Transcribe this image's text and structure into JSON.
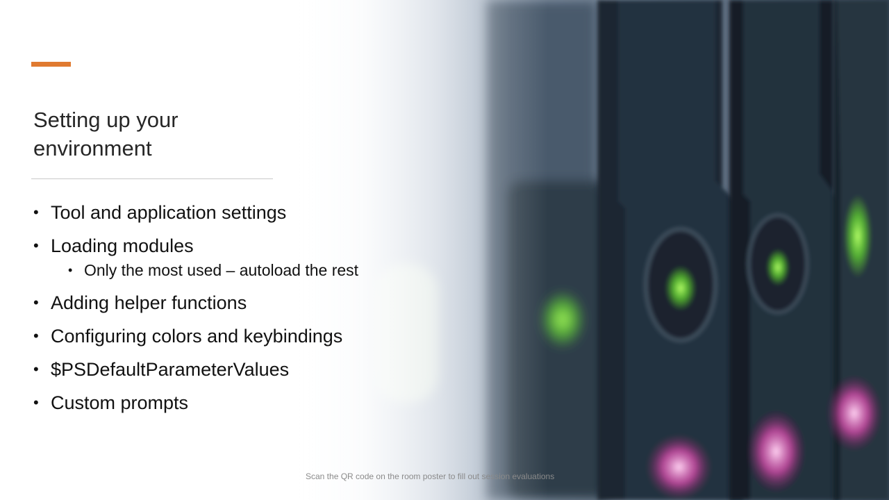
{
  "slide": {
    "title_lines": [
      "Setting up your",
      "environment"
    ],
    "bullets": [
      {
        "text": "Tool and application settings"
      },
      {
        "text": "Loading modules",
        "sub": "Only the most used – autoload the rest"
      },
      {
        "text": "Adding helper functions"
      },
      {
        "text": "Configuring colors and keybindings"
      },
      {
        "text": "$PSDefaultParameterValues"
      },
      {
        "text": "Custom prompts"
      }
    ],
    "bullet_glyph": "•",
    "footer": "Scan the QR code on the room poster to fill out session evaluations"
  },
  "colors": {
    "accent": "#e07a30",
    "title": "#262626",
    "body_text": "#111111",
    "footer_text": "#8a8a8a",
    "led_green": "#7dff3a",
    "led_magenta": "#d24aa8",
    "server_dark": "#1b2630"
  }
}
